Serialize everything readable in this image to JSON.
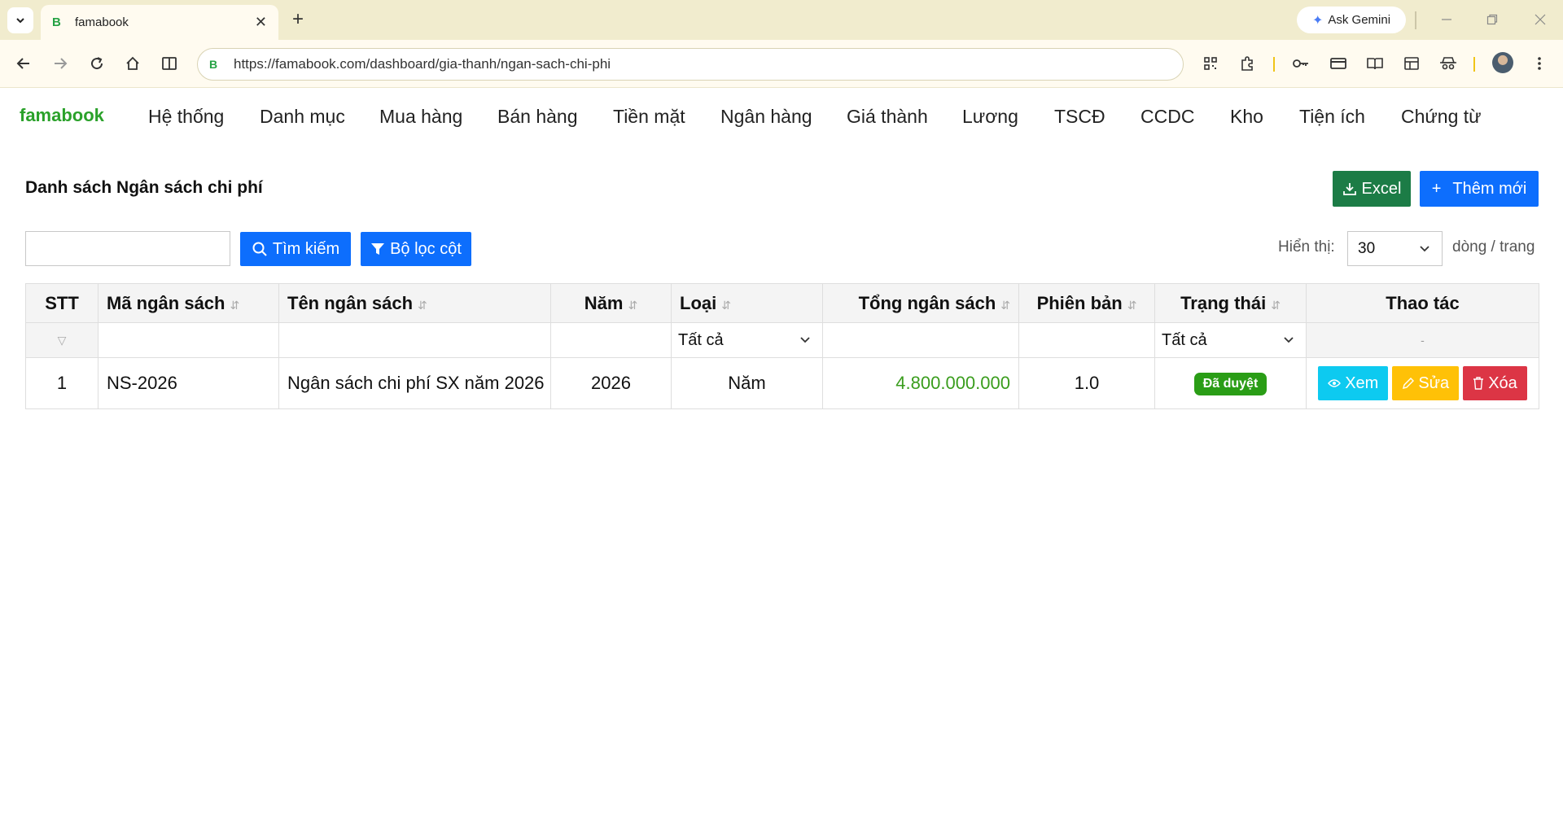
{
  "browser": {
    "tab_title": "famabook",
    "favicon_letter": "B",
    "new_tab_symbol": "+",
    "close_symbol": "✕",
    "gemini_label": "Ask Gemini",
    "url": "https://famabook.com/dashboard/gia-thanh/ngan-sach-chi-phi"
  },
  "nav": {
    "brand": "famabook",
    "items": [
      "Hệ thống",
      "Danh mục",
      "Mua hàng",
      "Bán hàng",
      "Tiền mặt",
      "Ngân hàng",
      "Giá thành",
      "Lương",
      "TSCĐ",
      "CCDC",
      "Kho",
      "Tiện ích",
      "Chứng từ"
    ]
  },
  "page": {
    "title": "Danh sách Ngân sách chi phí",
    "excel_label": "Excel",
    "add_label": "Thêm mới",
    "search_value": "",
    "search_label": "Tìm kiếm",
    "filter_label": "Bộ lọc cột",
    "show_label": "Hiển thị:",
    "page_size": "30",
    "rows_label": "dòng / trang"
  },
  "table": {
    "headers": {
      "stt": "STT",
      "code": "Mã ngân sách",
      "name": "Tên ngân sách",
      "year": "Năm",
      "type": "Loại",
      "total": "Tổng ngân sách",
      "version": "Phiên bản",
      "status": "Trạng thái",
      "actions": "Thao tác"
    },
    "filters": {
      "type": "Tất cả",
      "status": "Tất cả",
      "actions": "-"
    },
    "rows": [
      {
        "stt": "1",
        "code": "NS-2026",
        "name": "Ngân sách chi phí SX năm 2026",
        "year": "2026",
        "type": "Năm",
        "total": "4.800.000.000",
        "version": "1.0",
        "status": "Đã duyệt",
        "view_label": "Xem",
        "edit_label": "Sửa",
        "delete_label": "Xóa"
      }
    ]
  },
  "colors": {
    "brand": "#2aa12a",
    "primary": "#0d6efd",
    "excel": "#1c7c46",
    "total_text": "#3a9d1d",
    "status_badge": "#2a9d16",
    "view": "#0dcaf0",
    "edit": "#ffc107",
    "delete": "#dc3545"
  }
}
